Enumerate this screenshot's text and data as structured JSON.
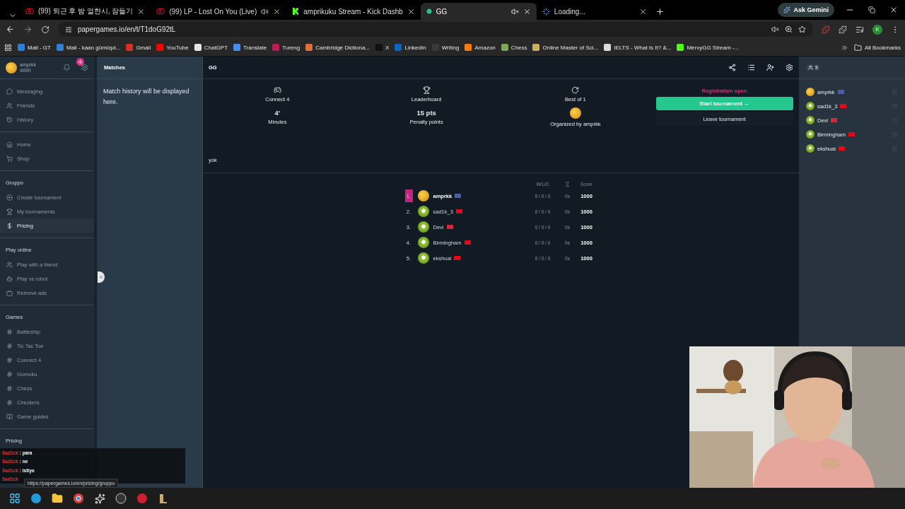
{
  "browser": {
    "tabs": [
      {
        "title": "(99) 퇴근 후 밤 열한시, 잠들기",
        "kind": "youtube",
        "playing": false,
        "muted": false,
        "selected": false
      },
      {
        "title": "(99) LP - Lost On You (Live)",
        "kind": "youtube",
        "playing": true,
        "muted": false,
        "selected": false
      },
      {
        "title": "amprikuku Stream - Kick Dashb",
        "kind": "kick",
        "playing": false,
        "muted": false,
        "selected": false
      },
      {
        "title": "GG",
        "kind": "dot",
        "playing": false,
        "muted": true,
        "selected": true
      },
      {
        "title": "Loading...",
        "kind": "loading",
        "playing": false,
        "muted": false,
        "selected": false
      }
    ],
    "ask_button": "Ask Gemini",
    "url": "papergames.io/en/t/T1doG92tL",
    "profile": "K",
    "bookmarks": [
      {
        "label": "Mail - GT",
        "color": "#2f7fd8"
      },
      {
        "label": "Mail - kaan gümüşd...",
        "color": "#2f7fd8"
      },
      {
        "label": "Gmail",
        "color": "#d93025"
      },
      {
        "label": "YouTube",
        "color": "#ff0000"
      },
      {
        "label": "ChatGPT",
        "color": "#e8e8e8"
      },
      {
        "label": "Translate",
        "color": "#4a8af4"
      },
      {
        "label": "Tureng",
        "color": "#c2185b"
      },
      {
        "label": "Cambridge Dictiona...",
        "color": "#e0703a"
      },
      {
        "label": "X",
        "color": "#101010"
      },
      {
        "label": "LinkedIn",
        "color": "#0a66c2"
      },
      {
        "label": "Writing",
        "color": "#3a3a3a"
      },
      {
        "label": "Amazon",
        "color": "#ff7a00"
      },
      {
        "label": "Chess",
        "color": "#7fa650"
      },
      {
        "label": "Online Master of Sci...",
        "color": "#c8b060"
      },
      {
        "label": "IELTS - What Is It? &...",
        "color": "#dddddd"
      },
      {
        "label": "MervyGG Stream -...",
        "color": "#53fc18"
      }
    ],
    "all_bookmarks": "All Bookmarks"
  },
  "sidebar": {
    "user": "amprkk",
    "coins": "4690",
    "notifications": "4",
    "sections": [
      {
        "items": [
          {
            "label": "Messaging",
            "selected": false
          },
          {
            "label": "Friends",
            "selected": false
          },
          {
            "label": "History",
            "selected": false
          }
        ]
      },
      {
        "items": [
          {
            "label": "Home",
            "selected": false
          },
          {
            "label": "Shop",
            "selected": false
          }
        ]
      },
      {
        "title": "Gruppo",
        "items": [
          {
            "label": "Create tournament",
            "selected": false
          },
          {
            "label": "My tournaments",
            "selected": false
          },
          {
            "label": "Pricing",
            "selected": true
          }
        ]
      },
      {
        "title": "Play online",
        "items": [
          {
            "label": "Play with a friend",
            "selected": false
          },
          {
            "label": "Play vs robot",
            "selected": false
          },
          {
            "label": "Remove ads",
            "selected": false
          }
        ]
      },
      {
        "title": "Games",
        "items": [
          {
            "label": "Battleship",
            "selected": false
          },
          {
            "label": "Tic Tac Toe",
            "selected": false
          },
          {
            "label": "Connect 4",
            "selected": false
          },
          {
            "label": "Gomoku",
            "selected": false
          },
          {
            "label": "Chess",
            "selected": false
          },
          {
            "label": "Checkers",
            "selected": false
          },
          {
            "label": "Game guides",
            "selected": false
          }
        ]
      },
      {
        "title": "Pricing"
      }
    ]
  },
  "matches": {
    "title": "Matches",
    "empty_text": "Match history will be displayed here."
  },
  "tournament": {
    "name": "GG",
    "info": [
      {
        "label": "Connect 4",
        "value": "4'",
        "caption": "Minutes"
      },
      {
        "label": "Leaderboard",
        "value": "15 pts",
        "caption": "Penalty points"
      },
      {
        "label": "Best of 1",
        "caption": "Organized by amprkk"
      }
    ],
    "status": "Registration open",
    "start_button": "Start tournament →",
    "leave_button": "Leave tournament",
    "description": "yok",
    "standings": {
      "columns": [
        "W/L/D",
        "Score"
      ],
      "rows": [
        {
          "rank": "1.",
          "name": "amprkk",
          "kind": "gold",
          "color": "#4a5fa8",
          "wld": "0 / 0 / 0",
          "time": "0s",
          "score": "1000",
          "highlighted": true
        },
        {
          "rank": "2.",
          "name": "sad1k_3",
          "kind": "green",
          "color": "#e30a17",
          "wld": "0 / 0 / 0",
          "time": "0s",
          "score": "1000",
          "highlighted": false
        },
        {
          "rank": "3.",
          "name": "Devi",
          "kind": "green",
          "color": "#cd2a3e",
          "wld": "0 / 0 / 0",
          "time": "0s",
          "score": "1000",
          "highlighted": false
        },
        {
          "rank": "4.",
          "name": "Birmingham",
          "kind": "green",
          "color": "#e30a17",
          "wld": "0 / 0 / 0",
          "time": "0s",
          "score": "1000",
          "highlighted": false
        },
        {
          "rank": "5.",
          "name": "ekshuai",
          "kind": "green",
          "color": "#e30a17",
          "wld": "0 / 0 / 0",
          "time": "0s",
          "score": "1000",
          "highlighted": false
        }
      ]
    }
  },
  "players": {
    "count": "5",
    "items": [
      {
        "name": "amprkk",
        "kind": "gold",
        "color": "#4a5fa8"
      },
      {
        "name": "sad1k_3",
        "kind": "green",
        "color": "#e30a17"
      },
      {
        "name": "Devi",
        "kind": "green",
        "color": "#cd2a3e"
      },
      {
        "name": "Birmingham",
        "kind": "green",
        "color": "#e30a17"
      },
      {
        "name": "ekshuai",
        "kind": "green",
        "color": "#e30a17"
      }
    ]
  },
  "chat": [
    {
      "user": "Sad1ck",
      "text": ": para"
    },
    {
      "user": "Sad1ck",
      "text": ": ne"
    },
    {
      "user": "Sad1ck",
      "text": ": istiyo"
    },
    {
      "user": "Sad1ck"
    }
  ],
  "status_url": "https://papergames.io/en/pricing/gruppo"
}
